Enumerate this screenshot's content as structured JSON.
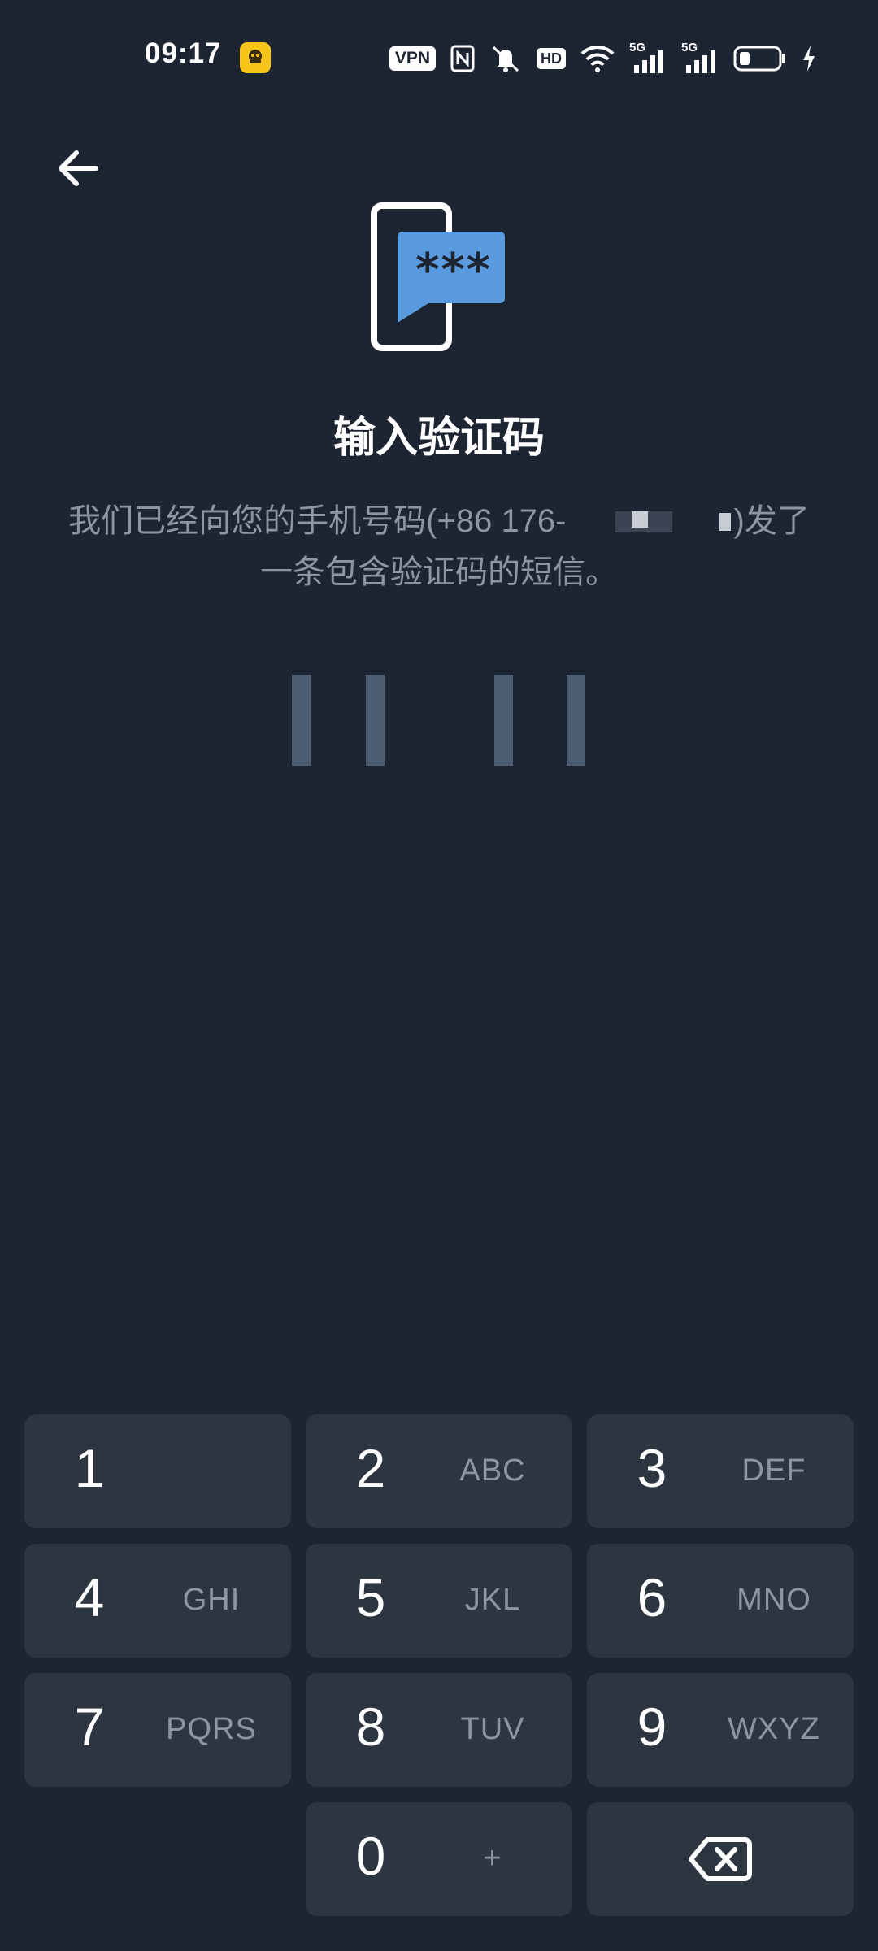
{
  "status_bar": {
    "time": "09:17",
    "vpn_label": "VPN",
    "hd_label": "HD",
    "signal1_label": "5G",
    "signal2_label": "5G",
    "icons": [
      "app-notification-icon",
      "vpn-icon",
      "nfc-icon",
      "mute-icon",
      "hd-icon",
      "wifi-icon",
      "signal-5g-icon",
      "signal-5g-icon",
      "battery-icon",
      "charging-icon"
    ]
  },
  "header": {
    "back_icon": "arrow-left-icon",
    "illustration_icon": "phone-sms-code-icon",
    "illustration_text": "***",
    "title": "输入验证码"
  },
  "description": {
    "line1_prefix": "我们已经向您的手机号码(+86 176-",
    "line1_suffix": ")发了",
    "line2": "一条包含验证码的短信。"
  },
  "code_input": {
    "length": 4,
    "values": [
      "",
      "",
      "",
      ""
    ]
  },
  "keypad": {
    "keys": [
      {
        "digit": "1",
        "letters": ""
      },
      {
        "digit": "2",
        "letters": "ABC"
      },
      {
        "digit": "3",
        "letters": "DEF"
      },
      {
        "digit": "4",
        "letters": "GHI"
      },
      {
        "digit": "5",
        "letters": "JKL"
      },
      {
        "digit": "6",
        "letters": "MNO"
      },
      {
        "digit": "7",
        "letters": "PQRS"
      },
      {
        "digit": "8",
        "letters": "TUV"
      },
      {
        "digit": "9",
        "letters": "WXYZ"
      },
      {
        "digit": "0",
        "letters": "+"
      }
    ],
    "backspace_icon": "backspace-icon"
  },
  "colors": {
    "background": "#1e2532",
    "key_background": "#2d3541",
    "accent_blue": "#5a9be0",
    "secondary_text": "#8b95a3",
    "code_slot": "#4d5e73"
  }
}
